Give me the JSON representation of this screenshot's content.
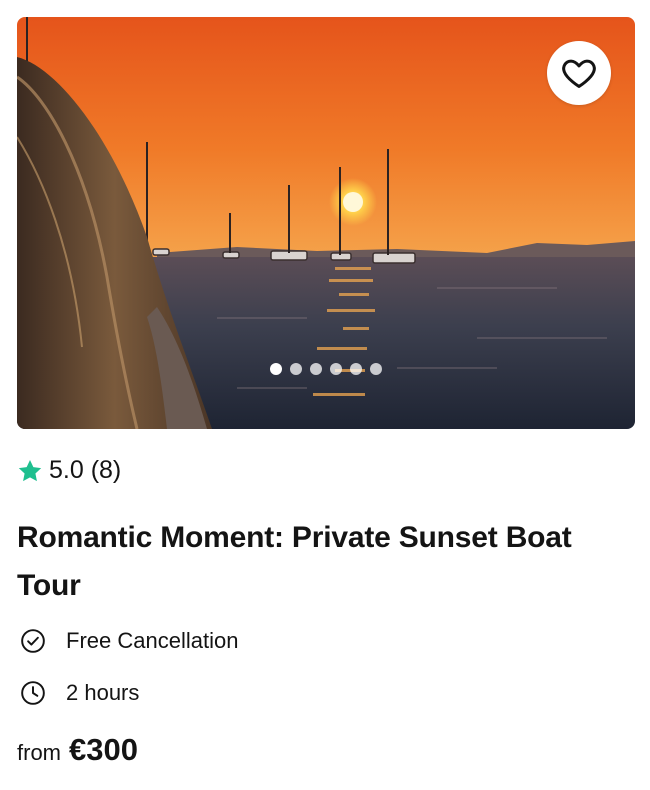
{
  "gallery": {
    "image_alt": "Sunset over the sea with sailboats",
    "dots": [
      {
        "active": true
      },
      {
        "active": false
      },
      {
        "active": false
      },
      {
        "active": false
      },
      {
        "active": false
      },
      {
        "active": false
      }
    ],
    "favorite_icon": "heart-icon"
  },
  "rating": {
    "icon": "star-icon",
    "text": "5.0 (8)",
    "color": "#1fbf8f"
  },
  "title": "Romantic Moment: Private Sunset Boat Tour",
  "features": {
    "cancellation": {
      "icon": "check-circle-icon",
      "label": "Free Cancellation"
    },
    "duration": {
      "icon": "clock-icon",
      "label": "2 hours"
    }
  },
  "price": {
    "prefix": "from",
    "value": "€300"
  }
}
